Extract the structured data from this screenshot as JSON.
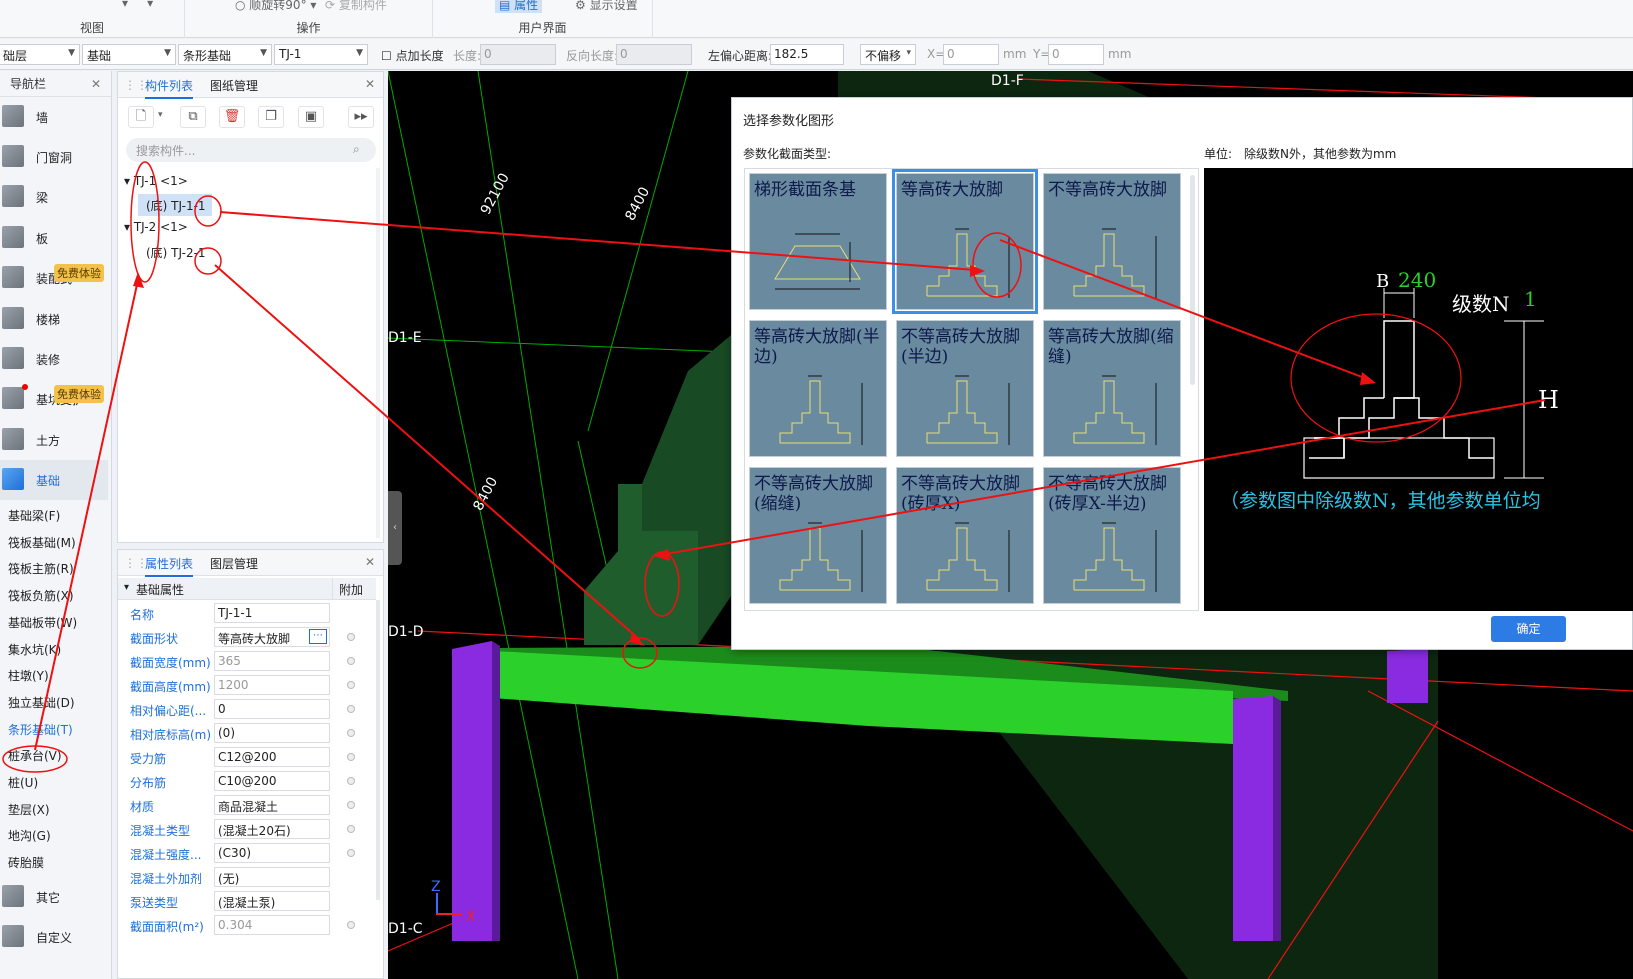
{
  "ribbon": {
    "view_label": "视图",
    "ops_label": "操作",
    "ui_label": "用户界面",
    "rotate_text": "顺旋转90°",
    "copy_text": "复制构件",
    "attr_text": "属性",
    "display_text": "显示设置"
  },
  "toolbar": {
    "floor": "础层",
    "category": "基础",
    "type": "条形基础",
    "element": "TJ-1",
    "point_len_label": "点加长度",
    "len_label": "长度:",
    "len_value": "0",
    "rev_len_label": "反向长度:",
    "rev_len_value": "0",
    "left_offset_label": "左偏心距离:",
    "left_offset_value": "182.5",
    "offset_mode": "不偏移",
    "x_label": "X=",
    "x_value": "0",
    "y_label": "Y=",
    "y_value": "0",
    "unit": "mm"
  },
  "nav": {
    "title": "导航栏",
    "items": [
      "墙",
      "门窗洞",
      "梁",
      "板",
      "装配式",
      "楼梯",
      "装修",
      "基坑支护",
      "土方",
      "基础"
    ],
    "badge": "免费体验",
    "sub": [
      "基础梁(F)",
      "筏板基础(M)",
      "筏板主筋(R)",
      "筏板负筋(X)",
      "基础板带(W)",
      "集水坑(K)",
      "柱墩(Y)",
      "独立基础(D)",
      "条形基础(T)",
      "桩承台(V)",
      "桩(U)",
      "垫层(X)",
      "地沟(G)",
      "砖胎膜"
    ],
    "other": "其它",
    "custom": "自定义"
  },
  "complist": {
    "tab1": "构件列表",
    "tab2": "图纸管理",
    "search_placeholder": "搜索构件...",
    "tree": [
      {
        "label": "TJ-1 <1>",
        "child": "(底) TJ-1-1"
      },
      {
        "label": "TJ-2 <1>",
        "child": "(底) TJ-2-1"
      }
    ]
  },
  "props": {
    "tab1": "属性列表",
    "tab2": "图层管理",
    "group": "基础属性",
    "extra": "附加",
    "rows": [
      {
        "name": "名称",
        "value": "TJ-1-1"
      },
      {
        "name": "截面形状",
        "value": "等高砖大放脚"
      },
      {
        "name": "截面宽度(mm)",
        "value": "365"
      },
      {
        "name": "截面高度(mm)",
        "value": "1200"
      },
      {
        "name": "相对偏心距(...",
        "value": "0"
      },
      {
        "name": "相对底标高(m)",
        "value": "(0)"
      },
      {
        "name": "受力筋",
        "value": "C12@200"
      },
      {
        "name": "分布筋",
        "value": "C10@200"
      },
      {
        "name": "材质",
        "value": "商品混凝土"
      },
      {
        "name": "混凝土类型",
        "value": "(混凝土20石)"
      },
      {
        "name": "混凝土强度...",
        "value": "(C30)"
      },
      {
        "name": "混凝土外加剂",
        "value": "(无)"
      },
      {
        "name": "泵送类型",
        "value": "(混凝土泵)"
      },
      {
        "name": "截面面积(m²)",
        "value": "0.304"
      }
    ]
  },
  "view3d": {
    "axis_labels": [
      "D1-F",
      "D1-E",
      "D1-D",
      "D1-C"
    ],
    "dims": [
      "92100",
      "8400",
      "8400"
    ],
    "axes": [
      "Z",
      "X"
    ]
  },
  "dialog": {
    "title": "选择参数化图形",
    "type_label": "参数化截面类型:",
    "unit_label": "单位:",
    "unit_text": "除级数N外，其他参数为mm",
    "shapes": [
      {
        "name": "梯形截面条基"
      },
      {
        "name": "等高砖大放脚"
      },
      {
        "name": "不等高砖大放脚"
      },
      {
        "name": "等高砖大放脚(半边)"
      },
      {
        "name": "不等高砖大放脚(半边)"
      },
      {
        "name": "等高砖大放脚(缩缝)"
      },
      {
        "name": "不等高砖大放脚(缩缝)"
      },
      {
        "name": "不等高砖大放脚(砖厚X)"
      },
      {
        "name": "不等高砖大放脚(砖厚X-半边)"
      }
    ],
    "preview": {
      "b_label": "B",
      "b_value": "240",
      "n_label": "级数N",
      "n_value": "1",
      "h_label": "H",
      "note": "（参数图中除级数N，其他参数单位均"
    },
    "ok": "确定"
  },
  "colors": {
    "accent": "#1e6fd9",
    "badge": "#f3c24a",
    "green": "#2bd02b",
    "purple": "#8a2be2"
  }
}
